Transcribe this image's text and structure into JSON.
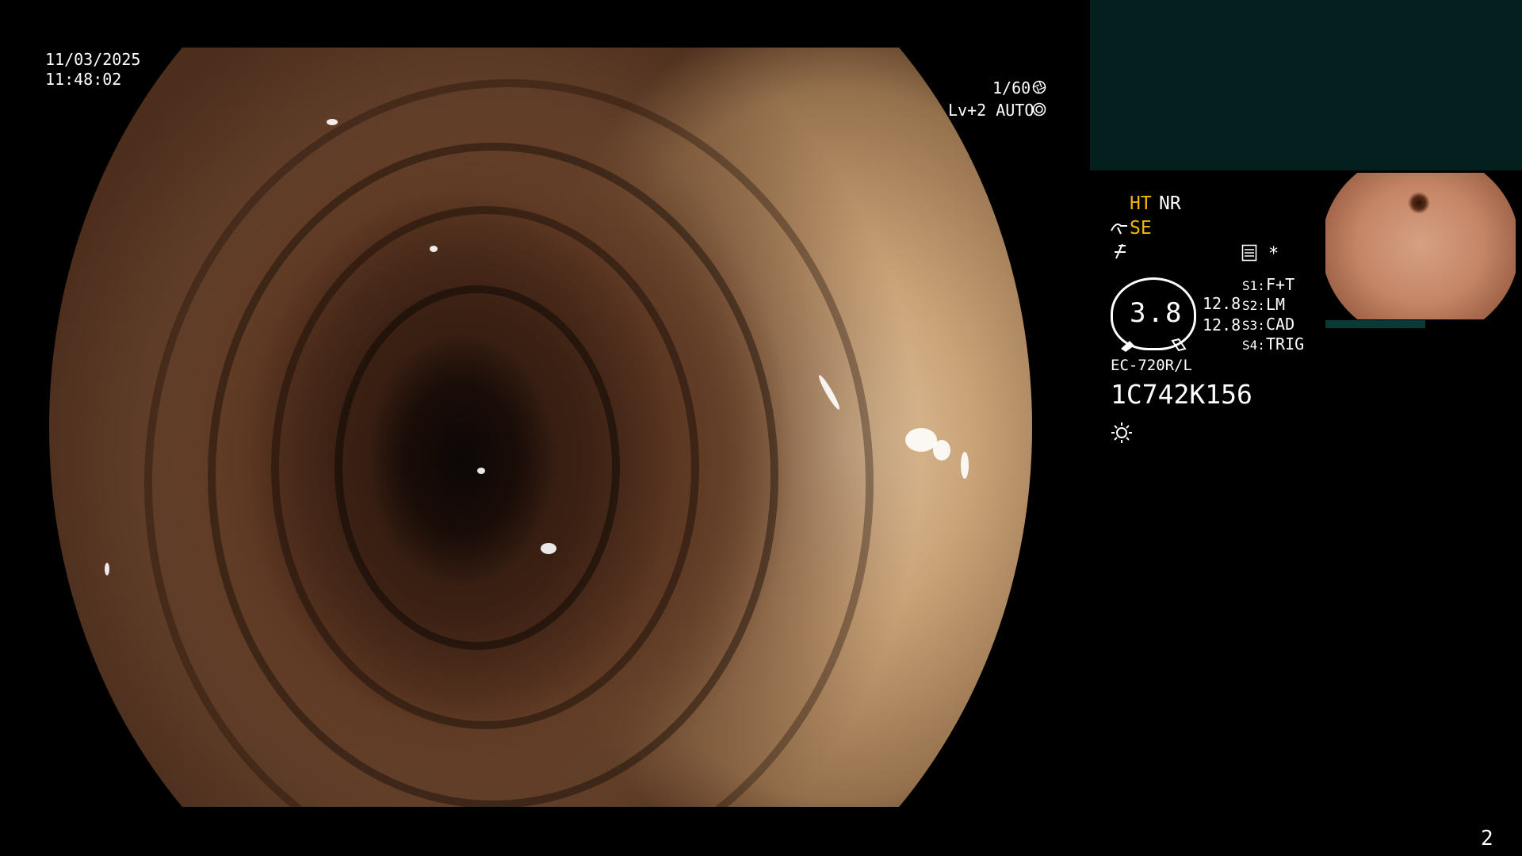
{
  "overlay": {
    "date": "11/03/2025",
    "time": "11:48:02",
    "shutter": "1/60",
    "level": "Lv+2 AUTO",
    "page_number": "2"
  },
  "panel": {
    "mode_ht": "HT",
    "mode_nr": "NR",
    "mode_se": "SE",
    "asterisk": "*",
    "gauge_value": "3.8",
    "reading_1": "12.8",
    "reading_2": "12.8",
    "switches": [
      {
        "key": "S1:",
        "value": "F+T"
      },
      {
        "key": "S2:",
        "value": "LM"
      },
      {
        "key": "S3:",
        "value": "CAD"
      },
      {
        "key": "S4:",
        "value": "TRIG"
      }
    ],
    "scope_model": "EC-720R/L",
    "serial": "1C742K156"
  },
  "icons": {
    "shutter": "aperture-icon",
    "auto": "auto-iris-icon",
    "scope": "scope-icon",
    "freeze": "freeze-icon",
    "memo": "memo-icon",
    "light": "light-icon"
  },
  "colors": {
    "accent_yellow": "#f0b800",
    "panel_teal": "#04201e"
  }
}
